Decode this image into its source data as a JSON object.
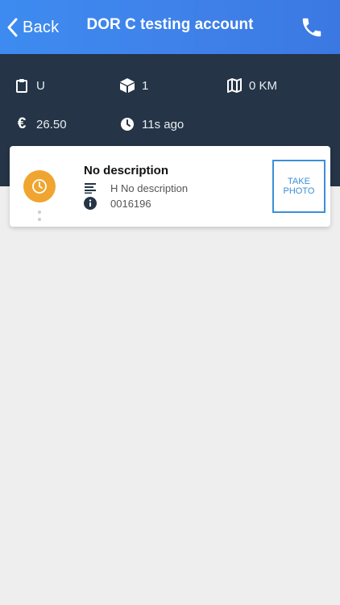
{
  "header": {
    "back_label": "Back",
    "title": "DOR C testing account",
    "icons": {
      "back": "chevron-left-icon",
      "call": "phone-icon"
    }
  },
  "stats": {
    "status": {
      "icon": "clipboard-icon",
      "value": "U"
    },
    "packages": {
      "icon": "box-icon",
      "value": "1"
    },
    "distance": {
      "icon": "map-icon",
      "value": "0 KM"
    },
    "price": {
      "icon": "euro-icon",
      "value": "26.50"
    },
    "updated": {
      "icon": "clock-icon",
      "value": "11s ago"
    }
  },
  "task": {
    "title": "No description",
    "description": "H No description",
    "reference": "0016196",
    "status_icon": "clock-icon",
    "status_color": "#f0a530",
    "photo_button": "TAKE PHOTO"
  },
  "colors": {
    "header": "#3f82ea",
    "stats_bg": "#253446",
    "accent": "#3a8fd8",
    "background": "#eeeeee"
  }
}
